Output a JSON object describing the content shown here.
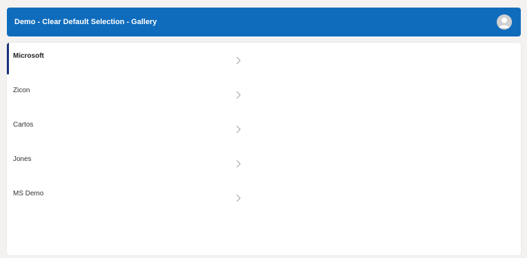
{
  "header": {
    "title": "Demo - Clear Default Selection - Gallery",
    "background_color": "#0f6cbd",
    "avatar_icon": "user-avatar-icon"
  },
  "gallery": {
    "selected_index": 0,
    "selection_accent_color": "#1b2f7a",
    "chevron_icon": "chevron-right-icon",
    "items": [
      {
        "label": "Microsoft"
      },
      {
        "label": "Zicon"
      },
      {
        "label": "Cartos"
      },
      {
        "label": "Jones"
      },
      {
        "label": "MS Demo"
      }
    ]
  }
}
